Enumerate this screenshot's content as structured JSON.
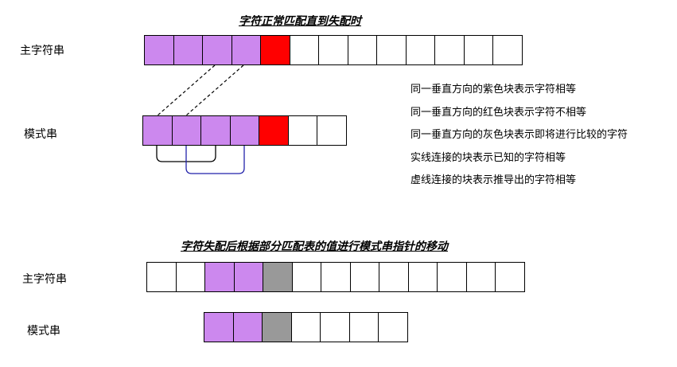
{
  "top": {
    "title": "字符正常匹配直到失配时",
    "main_label": "主字符串",
    "pattern_label": "模式串",
    "main_cells": [
      "#cc88ee",
      "#cc88ee",
      "#cc88ee",
      "#cc88ee",
      "#ff0000",
      "#ffffff",
      "#ffffff",
      "#ffffff",
      "#ffffff",
      "#ffffff",
      "#ffffff",
      "#ffffff",
      "#ffffff"
    ],
    "pattern_cells": [
      "#cc88ee",
      "#cc88ee",
      "#cc88ee",
      "#cc88ee",
      "#ff0000",
      "#ffffff",
      "#ffffff"
    ]
  },
  "legend": [
    "同一垂直方向的紫色块表示字符相等",
    "同一垂直方向的红色块表示字符不相等",
    "同一垂直方向的灰色块表示即将进行比较的字符",
    "实线连接的块表示已知的字符相等",
    "虚线连接的块表示推导出的字符相等"
  ],
  "bottom": {
    "title": "字符失配后根据部分匹配表的值进行模式串指针的移动",
    "main_label": "主字符串",
    "pattern_label": "模式串",
    "main_cells": [
      "#ffffff",
      "#ffffff",
      "#cc88ee",
      "#cc88ee",
      "#999999",
      "#ffffff",
      "#ffffff",
      "#ffffff",
      "#ffffff",
      "#ffffff",
      "#ffffff",
      "#ffffff",
      "#ffffff"
    ],
    "pattern_cells": [
      "#cc88ee",
      "#cc88ee",
      "#999999",
      "#ffffff",
      "#ffffff",
      "#ffffff",
      "#ffffff"
    ]
  },
  "colors": {
    "purple": "#cc88ee",
    "red": "#ff0000",
    "gray": "#999999",
    "solid_bracket_black": "#000000",
    "solid_bracket_blue": "#2222aa"
  }
}
